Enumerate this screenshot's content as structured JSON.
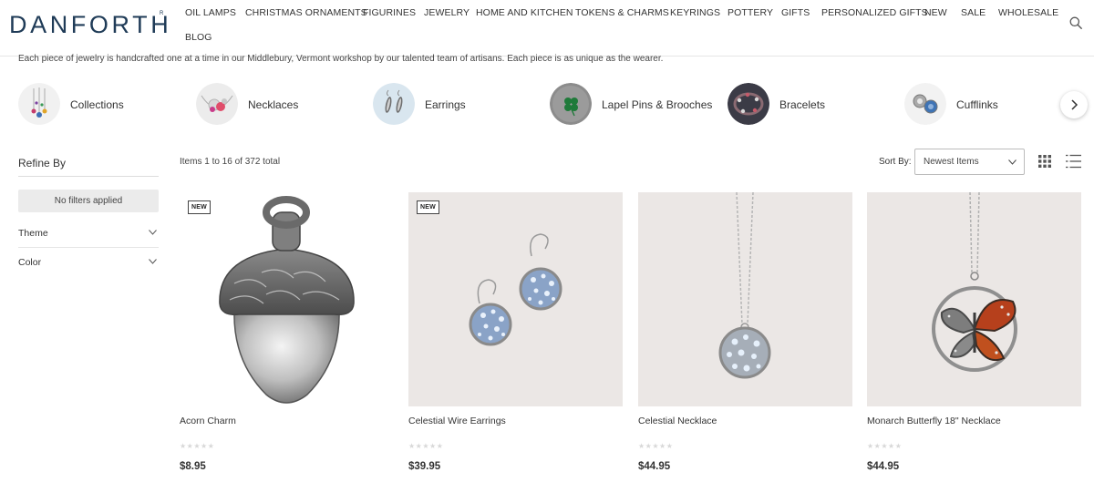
{
  "header": {
    "logo": "DANFORTH",
    "logo_mark": "R",
    "nav": [
      "OIL LAMPS",
      "CHRISTMAS ORNAMENTS",
      "FIGURINES",
      "JEWELRY",
      "HOME AND KITCHEN",
      "TOKENS & CHARMS",
      "KEYRINGS",
      "POTTERY",
      "GIFTS",
      "PERSONALIZED GIFTS",
      "NEW",
      "SALE",
      "WHOLESALE",
      "BLOG"
    ],
    "search_icon": "search-icon"
  },
  "intro": "Each piece of jewelry is handcrafted one at a time in our Middlebury, Vermont workshop by our talented team of artisans. Each piece is as unique as the wearer.",
  "categories": [
    {
      "label": "Collections"
    },
    {
      "label": "Necklaces"
    },
    {
      "label": "Earrings"
    },
    {
      "label": "Lapel Pins & Brooches"
    },
    {
      "label": "Bracelets"
    },
    {
      "label": "Cufflinks"
    }
  ],
  "sidebar": {
    "title": "Refine By",
    "no_filters": "No filters applied",
    "filters": [
      {
        "label": "Theme"
      },
      {
        "label": "Color"
      }
    ]
  },
  "toolbar": {
    "items_count": "Items 1 to 16 of 372 total",
    "sort_label": "Sort By:",
    "sort_value": "Newest Items"
  },
  "products": [
    {
      "name": "Acorn Charm",
      "price": "$8.95",
      "badge": "NEW",
      "rating": 0,
      "stars": "★★★★★"
    },
    {
      "name": "Celestial Wire Earrings",
      "price": "$39.95",
      "badge": "NEW",
      "rating": 0,
      "stars": "★★★★★"
    },
    {
      "name": "Celestial Necklace",
      "price": "$44.95",
      "badge": "",
      "rating": 0,
      "stars": "★★★★★"
    },
    {
      "name": "Monarch Butterfly 18\" Necklace",
      "price": "$44.95",
      "badge": "",
      "rating": 0,
      "stars": "★★★★★"
    }
  ],
  "colors": {
    "brand": "#1f3b57",
    "text": "#333333",
    "pill_bg": "#ebebeb",
    "star_empty": "#d8d8d8"
  }
}
